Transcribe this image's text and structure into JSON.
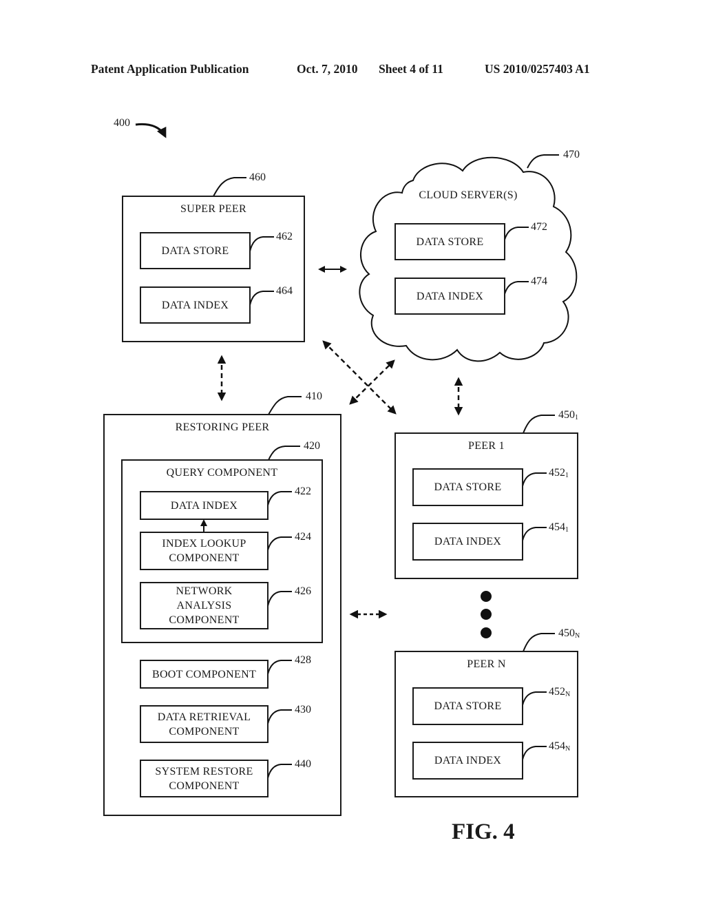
{
  "header": {
    "publication": "Patent Application Publication",
    "date": "Oct. 7, 2010",
    "sheet": "Sheet 4 of 11",
    "number": "US 2010/0257403 A1"
  },
  "figure": {
    "ref": "400",
    "label": "FIG. 4"
  },
  "super_peer": {
    "ref": "460",
    "title": "SUPER PEER",
    "data_store": {
      "label": "DATA STORE",
      "ref": "462"
    },
    "data_index": {
      "label": "DATA INDEX",
      "ref": "464"
    }
  },
  "cloud": {
    "ref": "470",
    "title": "CLOUD SERVER(S)",
    "data_store": {
      "label": "DATA STORE",
      "ref": "472"
    },
    "data_index": {
      "label": "DATA INDEX",
      "ref": "474"
    }
  },
  "restoring_peer": {
    "ref": "410",
    "title": "RESTORING PEER",
    "query_component": {
      "ref": "420",
      "title": "QUERY COMPONENT",
      "data_index": {
        "label": "DATA INDEX",
        "ref": "422"
      },
      "index_lookup": {
        "line1": "INDEX LOOKUP",
        "line2": "COMPONENT",
        "ref": "424"
      },
      "network_analysis": {
        "line1": "NETWORK",
        "line2": "ANALYSIS",
        "line3": "COMPONENT",
        "ref": "426"
      }
    },
    "boot": {
      "label": "BOOT COMPONENT",
      "ref": "428"
    },
    "data_retrieval": {
      "line1": "DATA RETRIEVAL",
      "line2": "COMPONENT",
      "ref": "430"
    },
    "system_restore": {
      "line1": "SYSTEM RESTORE",
      "line2": "COMPONENT",
      "ref": "440"
    }
  },
  "peer_1": {
    "ref_base": "450",
    "ref_sub": "1",
    "title": "PEER 1",
    "data_store": {
      "label": "DATA STORE",
      "ref_base": "452",
      "ref_sub": "1"
    },
    "data_index": {
      "label": "DATA INDEX",
      "ref_base": "454",
      "ref_sub": "1"
    }
  },
  "peer_n": {
    "ref_base": "450",
    "ref_sub": "N",
    "title": "PEER N",
    "data_store": {
      "label": "DATA STORE",
      "ref_base": "452",
      "ref_sub": "N"
    },
    "data_index": {
      "label": "DATA INDEX",
      "ref_base": "454",
      "ref_sub": "N"
    }
  }
}
